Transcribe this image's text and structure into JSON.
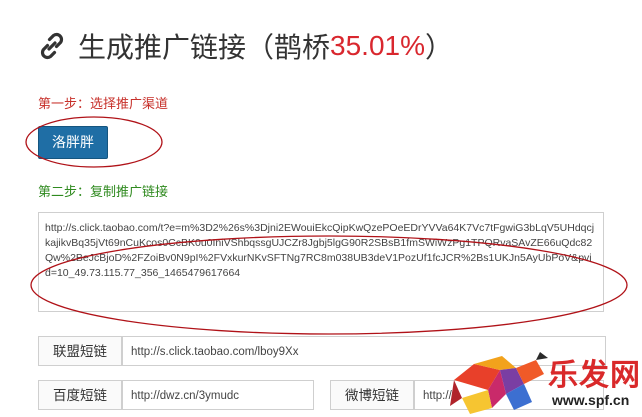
{
  "header": {
    "title_main": "生成推广链接（鹊桥",
    "title_percent": "35.01%",
    "title_close": "）"
  },
  "steps": {
    "step1_label": "第一步：选择推广渠道",
    "step2_label": "第二步：复制推广链接"
  },
  "channel_button_label": "洛胖胖",
  "promo_url": "http://s.click.taobao.com/t?e=m%3D2%26s%3Djni2EWouiEkcQipKwQzePOeEDrYVVa64K7Vc7tFgwiG3bLqV5UHdqcjkajikvBq35jVt69nCuKcos0CcBK0u0IniVShbqssgUJCZr8Jgbj5lgG90R2SBsB1fmSWiWzPg1TPQRvaSAvZE66uQdc82Qw%2BeJcBjoD%2FZoiBv0N9pI%2FVxkurNKvSFTNg7RC8m038UB3deV1PozUf1fcJCR%2Bs1UKJn5AyUbPoV&pvid=10_49.73.115.77_356_1465479617664",
  "short_links": {
    "lianmeng_label": "联盟短链",
    "lianmeng_value": "http://s.click.taobao.com/lboy9Xx",
    "baidu_label": "百度短链",
    "baidu_value": "http://dwz.cn/3ymudc",
    "weibo_label": "微博短链",
    "weibo_value": "http://t."
  },
  "watermark": {
    "brand": "乐发网",
    "url": "www.spf.cn"
  },
  "colors": {
    "accent_red": "#d9272e",
    "step_green": "#2f8a1f",
    "button_blue": "#1f6ea5"
  }
}
